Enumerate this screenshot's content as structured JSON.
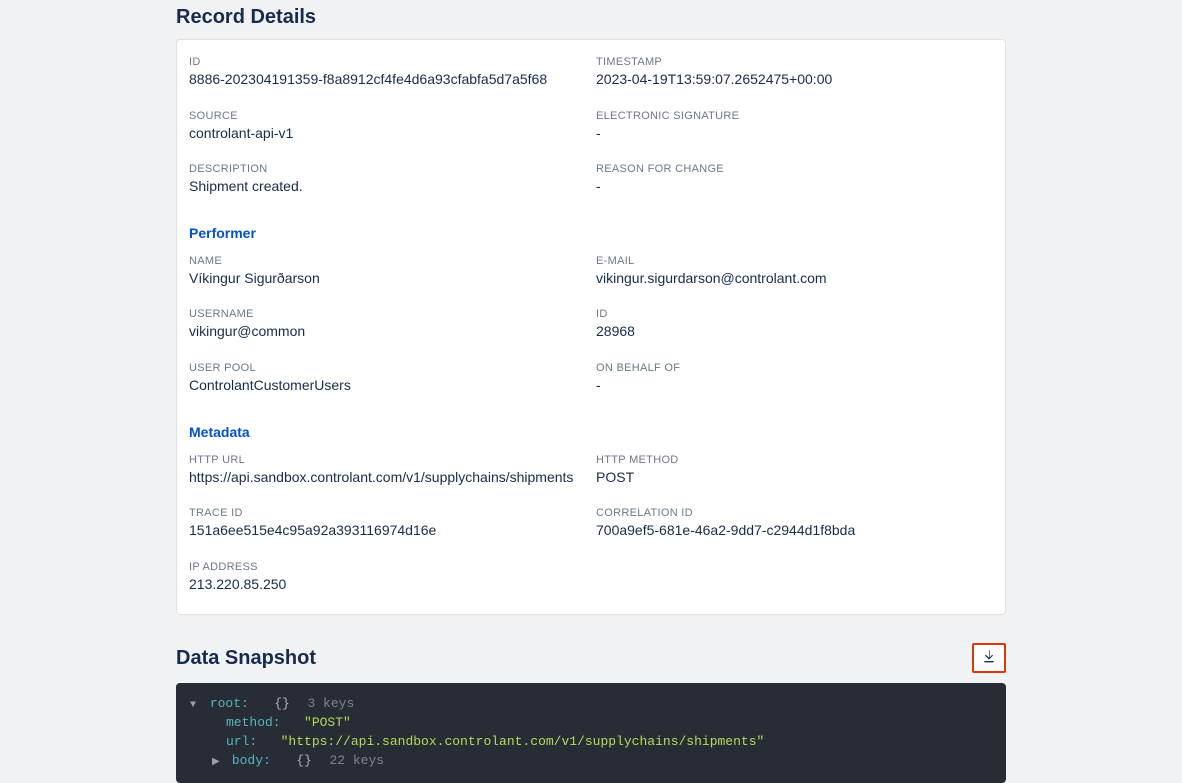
{
  "section_title": "Record Details",
  "record": {
    "id_label": "ID",
    "id_value": "8886-202304191359-f8a8912cf4fe4d6a93cfabfa5d7a5f68",
    "timestamp_label": "TIMESTAMP",
    "timestamp_value": "2023-04-19T13:59:07.2652475+00:00",
    "source_label": "SOURCE",
    "source_value": "controlant-api-v1",
    "esig_label": "ELECTRONIC SIGNATURE",
    "esig_value": "-",
    "desc_label": "DESCRIPTION",
    "desc_value": "Shipment created.",
    "reason_label": "REASON FOR CHANGE",
    "reason_value": "-"
  },
  "performer_title": "Performer",
  "performer": {
    "name_label": "NAME",
    "name_value": "Víkingur Sigurðarson",
    "email_label": "E-MAIL",
    "email_value": "vikingur.sigurdarson@controlant.com",
    "username_label": "USERNAME",
    "username_value": "vikingur@common",
    "id_label": "ID",
    "id_value": "28968",
    "userpool_label": "USER POOL",
    "userpool_value": "ControlantCustomerUsers",
    "onbehalf_label": "ON BEHALF OF",
    "onbehalf_value": "-"
  },
  "metadata_title": "Metadata",
  "metadata": {
    "httpurl_label": "HTTP URL",
    "httpurl_value": "https://api.sandbox.controlant.com/v1/supplychains/shipments",
    "httpmethod_label": "HTTP METHOD",
    "httpmethod_value": "POST",
    "traceid_label": "TRACE ID",
    "traceid_value": "151a6ee515e4c95a92a393116974d16e",
    "corrid_label": "CORRELATION ID",
    "corrid_value": "700a9ef5-681e-46a2-9dd7-c2944d1f8bda",
    "ip_label": "IP ADDRESS",
    "ip_value": "213.220.85.250"
  },
  "snapshot_title": "Data Snapshot",
  "json": {
    "root_key": "root:",
    "root_meta": "3 keys",
    "method_key": "method:",
    "method_val": "\"POST\"",
    "url_key": "url:",
    "url_val": "\"https://api.sandbox.controlant.com/v1/supplychains/shipments\"",
    "body_key": "body:",
    "body_meta": "22 keys",
    "brace": "{}"
  }
}
